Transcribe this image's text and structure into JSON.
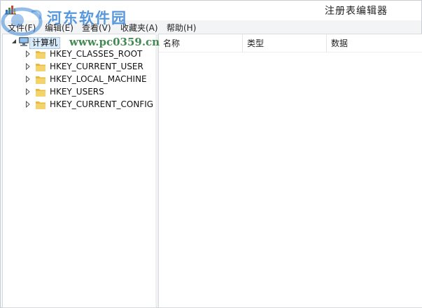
{
  "window": {
    "title": "注册表编辑器"
  },
  "watermark": {
    "title": "河东软件园",
    "url": "www.pc0359.cn"
  },
  "menu": [
    {
      "label": "文件(F)"
    },
    {
      "label": "编辑(E)"
    },
    {
      "label": "查看(V)"
    },
    {
      "label": "收藏夹(A)"
    },
    {
      "label": "帮助(H)"
    }
  ],
  "tree": {
    "root": "计算机",
    "children": [
      "HKEY_CLASSES_ROOT",
      "HKEY_CURRENT_USER",
      "HKEY_LOCAL_MACHINE",
      "HKEY_USERS",
      "HKEY_CURRENT_CONFIG"
    ]
  },
  "list": {
    "columns": [
      "名称",
      "类型",
      "数据"
    ]
  },
  "colors": {
    "folder": "#e8b93a",
    "selection": "#d9ebf9",
    "watermark_blue": "#3a86d6",
    "watermark_green": "#2f7e3f"
  },
  "icons": {
    "app": "regedit-icon",
    "computer": "computer-icon",
    "folder": "folder-icon",
    "expander": "expand-arrow-icon"
  }
}
